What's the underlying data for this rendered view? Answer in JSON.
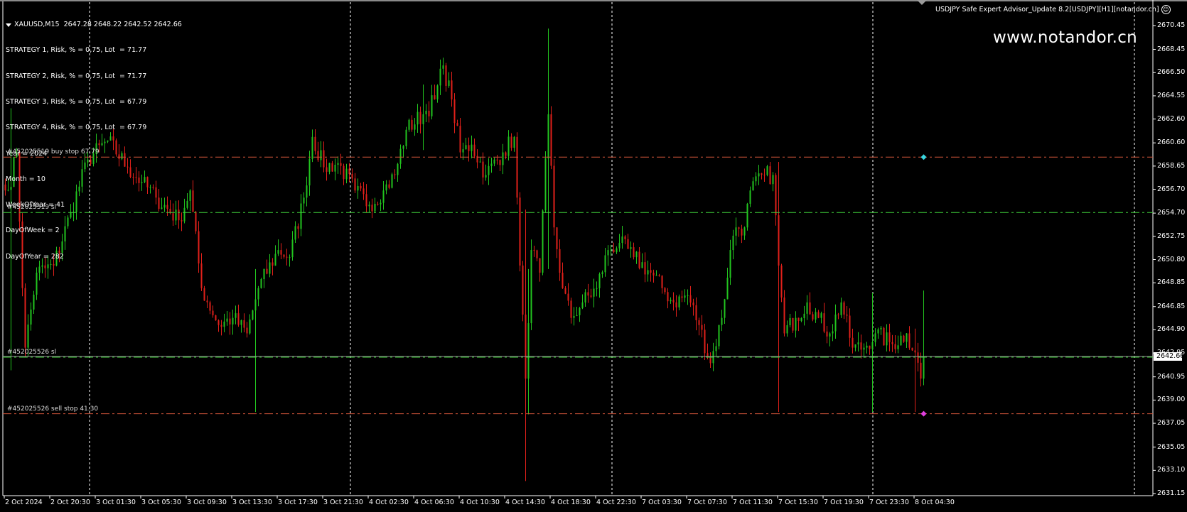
{
  "header": {
    "symbol_line": "XAUUSD,M15  2647.28 2648.22 2642.52 2642.66",
    "info_lines": [
      "STRATEGY 1, Risk, % = 0,75, Lot  = 71.77",
      "STRATEGY 2, Risk, % = 0,75, Lot  = 71.77",
      "STRATEGY 3, Risk, % = 0,75, Lot  = 67.79",
      "STRATEGY 4, Risk, % = 0,75, Lot  = 67.79",
      "Year = 2024",
      "Month = 10",
      "WeekOfYear = 41",
      "DayOfWeek = 2",
      "DayOfYear = 282"
    ],
    "ea_name": "USDJPY Safe Expert Advisor_Update 8.2[USDJPY][H1][notandor.cn]",
    "watermark": "www.notandor.cn"
  },
  "colors": {
    "bull": "#22c51f",
    "bear": "#e0201a",
    "buy_line": "#d2543a",
    "sl_line": "#3fcf3a",
    "grid": "#ffffff",
    "buy_marker": "#39d6e0",
    "sell_marker": "#e040e0"
  },
  "chart_data": {
    "type": "candlestick",
    "symbol": "XAUUSD",
    "timeframe": "M15",
    "ylim": [
      2631.15,
      2670.45
    ],
    "y_ticks": [
      "2670.45",
      "2668.45",
      "2666.50",
      "2664.55",
      "2662.60",
      "2660.60",
      "2658.65",
      "2656.70",
      "2654.70",
      "2652.75",
      "2650.80",
      "2648.85",
      "2646.85",
      "2644.90",
      "2642.95",
      "2640.95",
      "2639.00",
      "2637.05",
      "2635.05",
      "2633.10",
      "2631.15"
    ],
    "current_price": "2642.66",
    "x_ticks": [
      "2 Oct 2024",
      "2 Oct 20:30",
      "3 Oct 01:30",
      "3 Oct 05:30",
      "3 Oct 09:30",
      "3 Oct 13:30",
      "3 Oct 17:30",
      "3 Oct 21:30",
      "4 Oct 02:30",
      "4 Oct 06:30",
      "4 Oct 10:30",
      "4 Oct 14:30",
      "4 Oct 18:30",
      "4 Oct 22:30",
      "7 Oct 03:30",
      "7 Oct 07:30",
      "7 Oct 11:30",
      "7 Oct 15:30",
      "7 Oct 19:30",
      "7 Oct 23:30",
      "8 Oct 04:30"
    ],
    "bars_per_tick": 16,
    "close_path_bar_price": [
      [
        0,
        2656.6
      ],
      [
        1,
        2656.65
      ],
      [
        4,
        2659.8
      ],
      [
        7,
        2643.4
      ],
      [
        11,
        2649.7
      ],
      [
        17,
        2650.3
      ],
      [
        23,
        2654.75
      ],
      [
        29,
        2659.2
      ],
      [
        36,
        2660.8
      ],
      [
        43,
        2658.55
      ],
      [
        48,
        2657.3
      ],
      [
        53,
        2656.0
      ],
      [
        61,
        2654.1
      ],
      [
        65,
        2656.6
      ],
      [
        69,
        2648.4
      ],
      [
        75,
        2645.3
      ],
      [
        80,
        2645.9
      ],
      [
        85,
        2644.6
      ],
      [
        89,
        2648.4
      ],
      [
        96,
        2651.6
      ],
      [
        100,
        2651.0
      ],
      [
        105,
        2656.0
      ],
      [
        108,
        2661.1
      ],
      [
        112,
        2658.55
      ],
      [
        117,
        2658.9
      ],
      [
        123,
        2656.6
      ],
      [
        128,
        2655.4
      ],
      [
        133,
        2656.6
      ],
      [
        137,
        2657.9
      ],
      [
        141,
        2661.7
      ],
      [
        147,
        2663.0
      ],
      [
        151,
        2664.25
      ],
      [
        154,
        2667.1
      ],
      [
        157,
        2664.25
      ],
      [
        160,
        2659.8
      ],
      [
        164,
        2660.45
      ],
      [
        169,
        2657.9
      ],
      [
        175,
        2659.8
      ],
      [
        179,
        2661.1
      ],
      [
        181,
        2650.3
      ],
      [
        183,
        2640.8
      ],
      [
        185,
        2651.6
      ],
      [
        188,
        2649.7
      ],
      [
        191,
        2663.0
      ],
      [
        193,
        2653.5
      ],
      [
        196,
        2648.4
      ],
      [
        199,
        2645.9
      ],
      [
        203,
        2647.2
      ],
      [
        208,
        2648.4
      ],
      [
        212,
        2651.6
      ],
      [
        216,
        2652.2
      ],
      [
        221,
        2651.0
      ],
      [
        227,
        2649.7
      ],
      [
        231,
        2648.4
      ],
      [
        235,
        2647.2
      ],
      [
        240,
        2647.8
      ],
      [
        244,
        2645.3
      ],
      [
        248,
        2642.1
      ],
      [
        252,
        2645.9
      ],
      [
        255,
        2651.6
      ],
      [
        257,
        2653.5
      ],
      [
        260,
        2653.5
      ],
      [
        262,
        2656.6
      ],
      [
        267,
        2657.9
      ],
      [
        270,
        2657.9
      ],
      [
        272,
        2650.3
      ],
      [
        274,
        2644.6
      ],
      [
        278,
        2645.9
      ],
      [
        282,
        2647.2
      ],
      [
        286,
        2645.9
      ],
      [
        290,
        2644.6
      ],
      [
        294,
        2647.2
      ],
      [
        298,
        2643.4
      ],
      [
        302,
        2643.4
      ],
      [
        306,
        2644.6
      ],
      [
        312,
        2643.7
      ],
      [
        317,
        2644.6
      ],
      [
        320,
        2643.0
      ],
      [
        322,
        2640.8
      ],
      [
        323,
        2642.66
      ]
    ],
    "spikes_bar_low_high": [
      [
        2,
        2641.5,
        2663.5
      ],
      [
        88,
        2638.0,
        2650.0
      ],
      [
        183,
        2632.2,
        2655.0
      ],
      [
        184,
        2637.8,
        2650.0
      ],
      [
        191,
        2650.0,
        2670.2
      ],
      [
        147,
        2660.0,
        2665.5
      ],
      [
        272,
        2638.0,
        2659.0
      ],
      [
        305,
        2638.0,
        2648.0
      ],
      [
        320,
        2638.0,
        2645.0
      ],
      [
        323,
        2641.0,
        2648.2
      ]
    ],
    "order_lines": [
      {
        "label": "#452025519 buy stop 67.79",
        "price": 2659.4,
        "kind": "pending"
      },
      {
        "label": "#452025519 sl",
        "price": 2654.75,
        "kind": "sl"
      },
      {
        "label": "#452025526 sl",
        "price": 2642.6,
        "kind": "sl"
      },
      {
        "label": "#452025526 sell stop 41.30",
        "price": 2637.85,
        "kind": "pending"
      }
    ],
    "markers": [
      {
        "price": 2659.4,
        "type": "buy"
      },
      {
        "price": 2637.85,
        "type": "sell"
      }
    ]
  }
}
